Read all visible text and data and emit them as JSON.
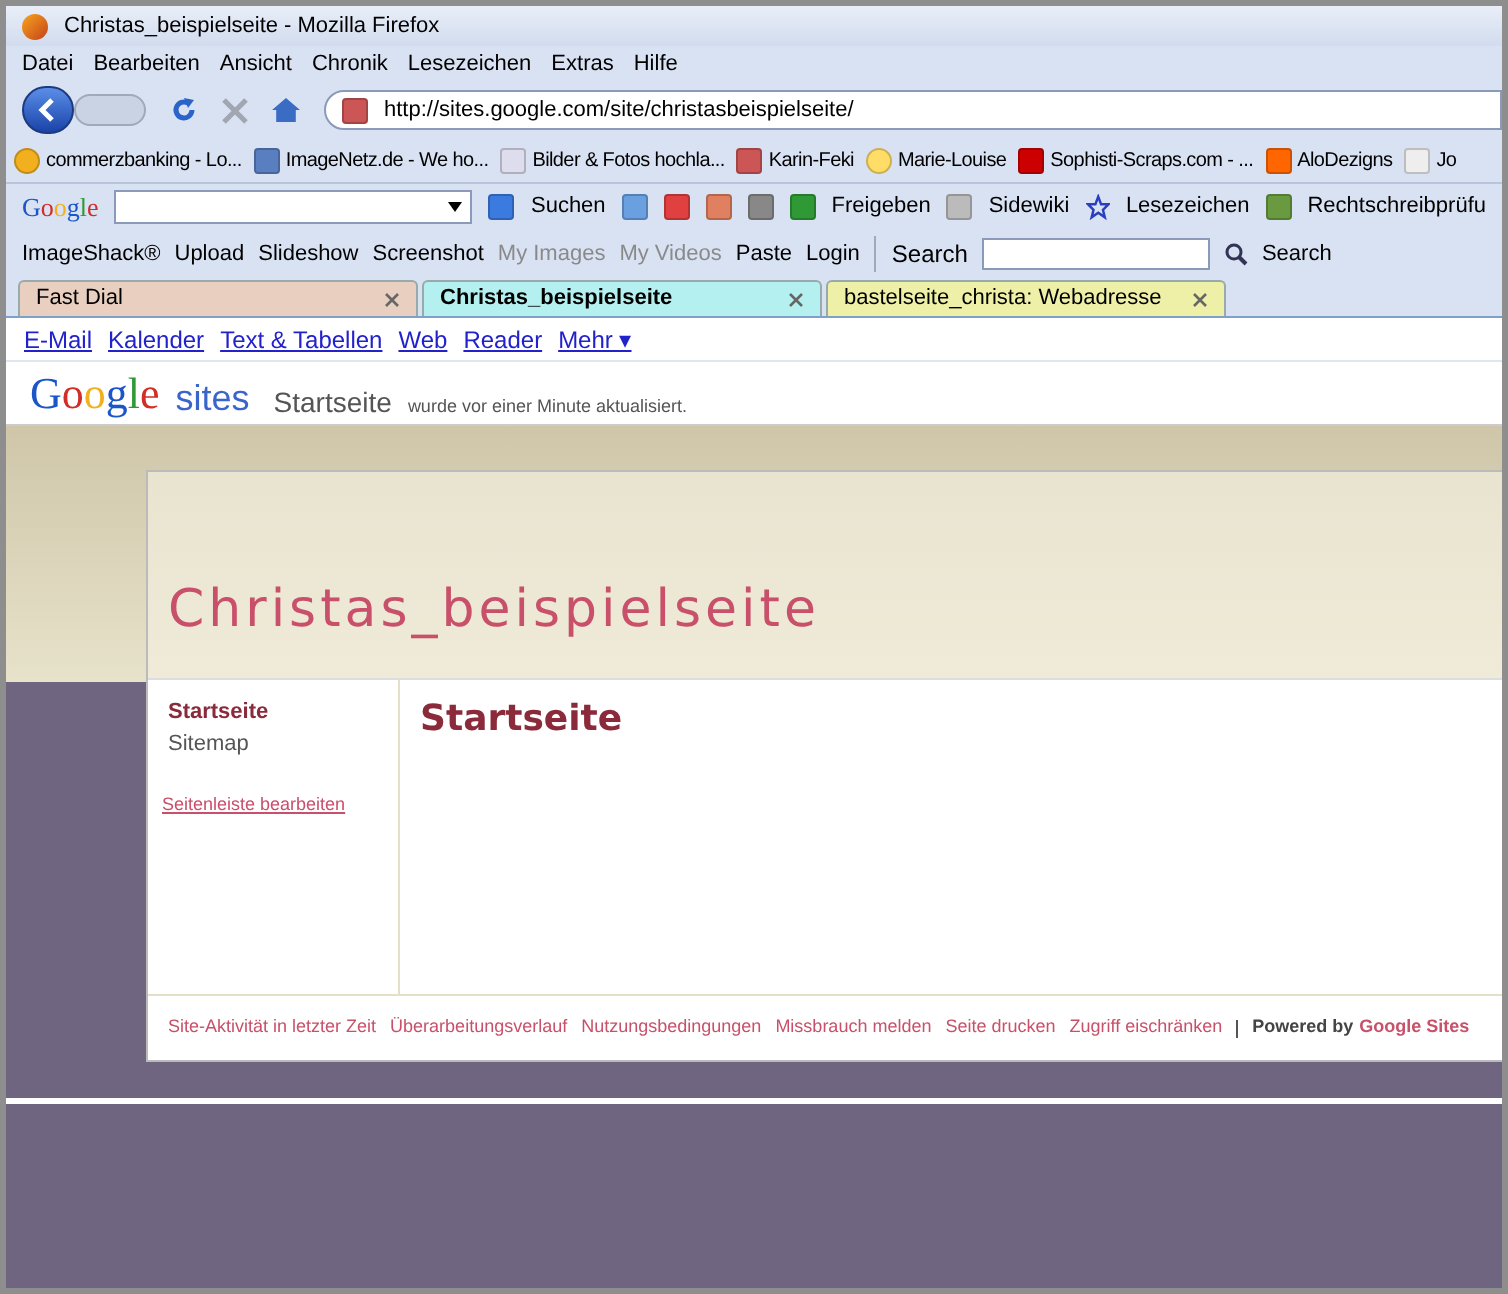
{
  "window": {
    "title": "Christas_beispielseite - Mozilla Firefox"
  },
  "menu": [
    "Datei",
    "Bearbeiten",
    "Ansicht",
    "Chronik",
    "Lesezeichen",
    "Extras",
    "Hilfe"
  ],
  "navigation": {
    "url": "http://sites.google.com/site/christasbeispielseite/"
  },
  "bookmarks": [
    "commerzbanking - Lo...",
    "ImageNetz.de - We ho...",
    "Bilder & Fotos hochla...",
    "Karin-Feki",
    "Marie-Louise",
    "Sophisti-Scraps.com - ...",
    "AloDezigns",
    "Jo"
  ],
  "google_toolbar": {
    "logo": "Google",
    "search_button": "Suchen",
    "share": "Freigeben",
    "sidewiki": "Sidewiki",
    "bookmarks": "Lesezeichen",
    "spellcheck": "Rechtschreibprüfu"
  },
  "imageshack_toolbar": {
    "items": [
      {
        "label": "ImageShack®",
        "disabled": false
      },
      {
        "label": "Upload",
        "disabled": false
      },
      {
        "label": "Slideshow",
        "disabled": false
      },
      {
        "label": "Screenshot",
        "disabled": false
      },
      {
        "label": "My Images",
        "disabled": true
      },
      {
        "label": "My Videos",
        "disabled": true
      },
      {
        "label": "Paste",
        "disabled": false
      },
      {
        "label": "Login",
        "disabled": false
      }
    ],
    "search_label": "Search",
    "search_button": "Search"
  },
  "tabs": [
    {
      "label": "Fast Dial",
      "selected": false,
      "color": "#e8cfc0"
    },
    {
      "label": "Christas_beispielseite",
      "selected": true,
      "color": "#b4f0f0"
    },
    {
      "label": "bastelseite_christa: Webadresse",
      "selected": false,
      "color": "#eef0a8"
    }
  ],
  "google_bar": [
    "E-Mail",
    "Kalender",
    "Text & Tabellen",
    "Web",
    "Reader",
    "Mehr ▾"
  ],
  "sites_header": {
    "logo": "Google",
    "product": "sites",
    "page": "Startseite",
    "updated": "wurde vor einer Minute aktualisiert."
  },
  "site": {
    "title": "Christas_beispielseite",
    "sidebar": [
      {
        "label": "Startseite",
        "selected": true
      },
      {
        "label": "Sitemap",
        "selected": false
      }
    ],
    "edit_sidebar": "Seitenleiste bearbeiten",
    "heading": "Startseite",
    "footer_links": [
      "Site-Aktivität in letzter Zeit",
      "Überarbeitungsverlauf",
      "Nutzungsbedingungen",
      "Missbrauch melden",
      "Seite drucken",
      "Zugriff eischränken"
    ],
    "powered_by": "Powered by",
    "powered_link": "Google Sites"
  }
}
